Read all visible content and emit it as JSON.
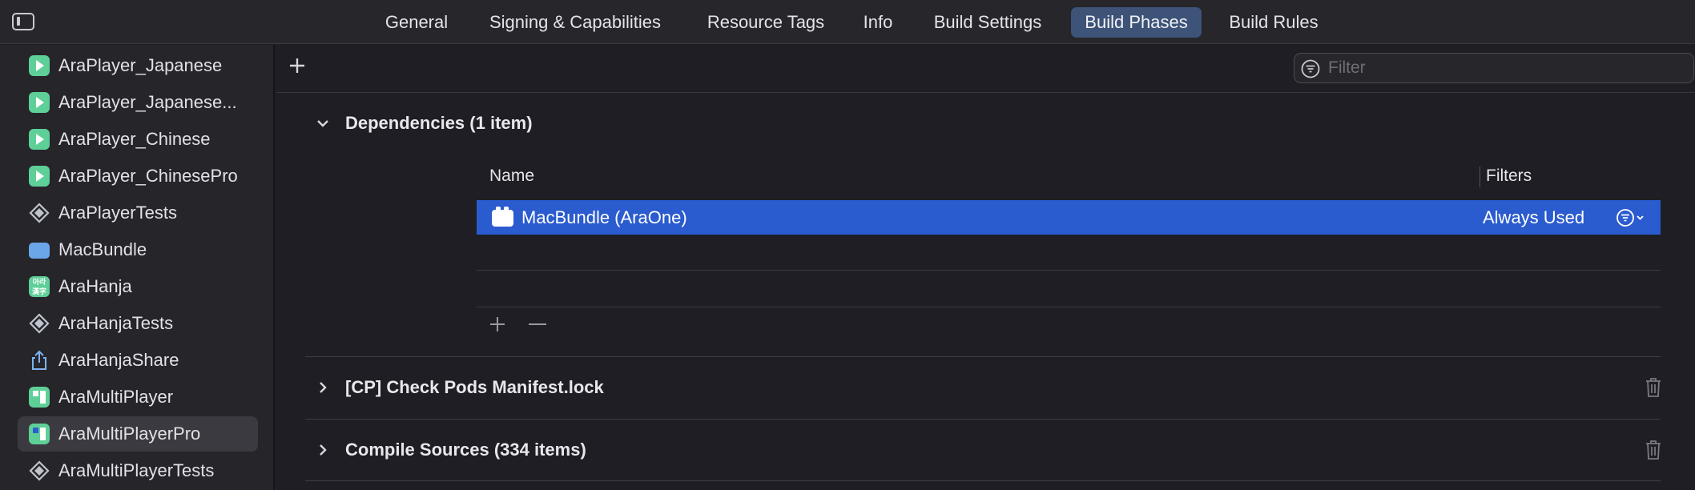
{
  "tabs": [
    {
      "label": "General",
      "active": false
    },
    {
      "label": "Signing & Capabilities",
      "active": false
    },
    {
      "label": "Resource Tags",
      "active": false
    },
    {
      "label": "Info",
      "active": false
    },
    {
      "label": "Build Settings",
      "active": false
    },
    {
      "label": "Build Phases",
      "active": true
    },
    {
      "label": "Build Rules",
      "active": false
    }
  ],
  "sidebar": {
    "items": [
      {
        "label": "AraPlayer_Japanese",
        "icon": "app-icon"
      },
      {
        "label": "AraPlayer_Japanese...",
        "icon": "app-icon"
      },
      {
        "label": "AraPlayer_Chinese",
        "icon": "app-icon"
      },
      {
        "label": "AraPlayer_ChinesePro",
        "icon": "app-icon"
      },
      {
        "label": "AraPlayerTests",
        "icon": "test-icon"
      },
      {
        "label": "MacBundle",
        "icon": "bundle-icon"
      },
      {
        "label": "AraHanja",
        "icon": "hanja-app-icon"
      },
      {
        "label": "AraHanjaTests",
        "icon": "test-icon"
      },
      {
        "label": "AraHanjaShare",
        "icon": "share-extension-icon"
      },
      {
        "label": "AraMultiPlayer",
        "icon": "multi-app-icon"
      },
      {
        "label": "AraMultiPlayerPro",
        "icon": "multi-app-icon",
        "selected": true
      },
      {
        "label": "AraMultiPlayerTests",
        "icon": "test-icon"
      }
    ]
  },
  "toolbar": {
    "filter_placeholder": "Filter"
  },
  "dependencies": {
    "title": "Dependencies (1 item)",
    "col_name": "Name",
    "col_filters": "Filters",
    "rows": [
      {
        "name": "MacBundle (AraOne)",
        "filter": "Always Used"
      }
    ]
  },
  "phases": [
    {
      "title": "[CP] Check Pods Manifest.lock"
    },
    {
      "title": "Compile Sources (334 items)"
    }
  ],
  "colors": {
    "selection": "#2a5bcf",
    "active_tab": "#3d5378",
    "app_icon": "#5fcf98"
  }
}
